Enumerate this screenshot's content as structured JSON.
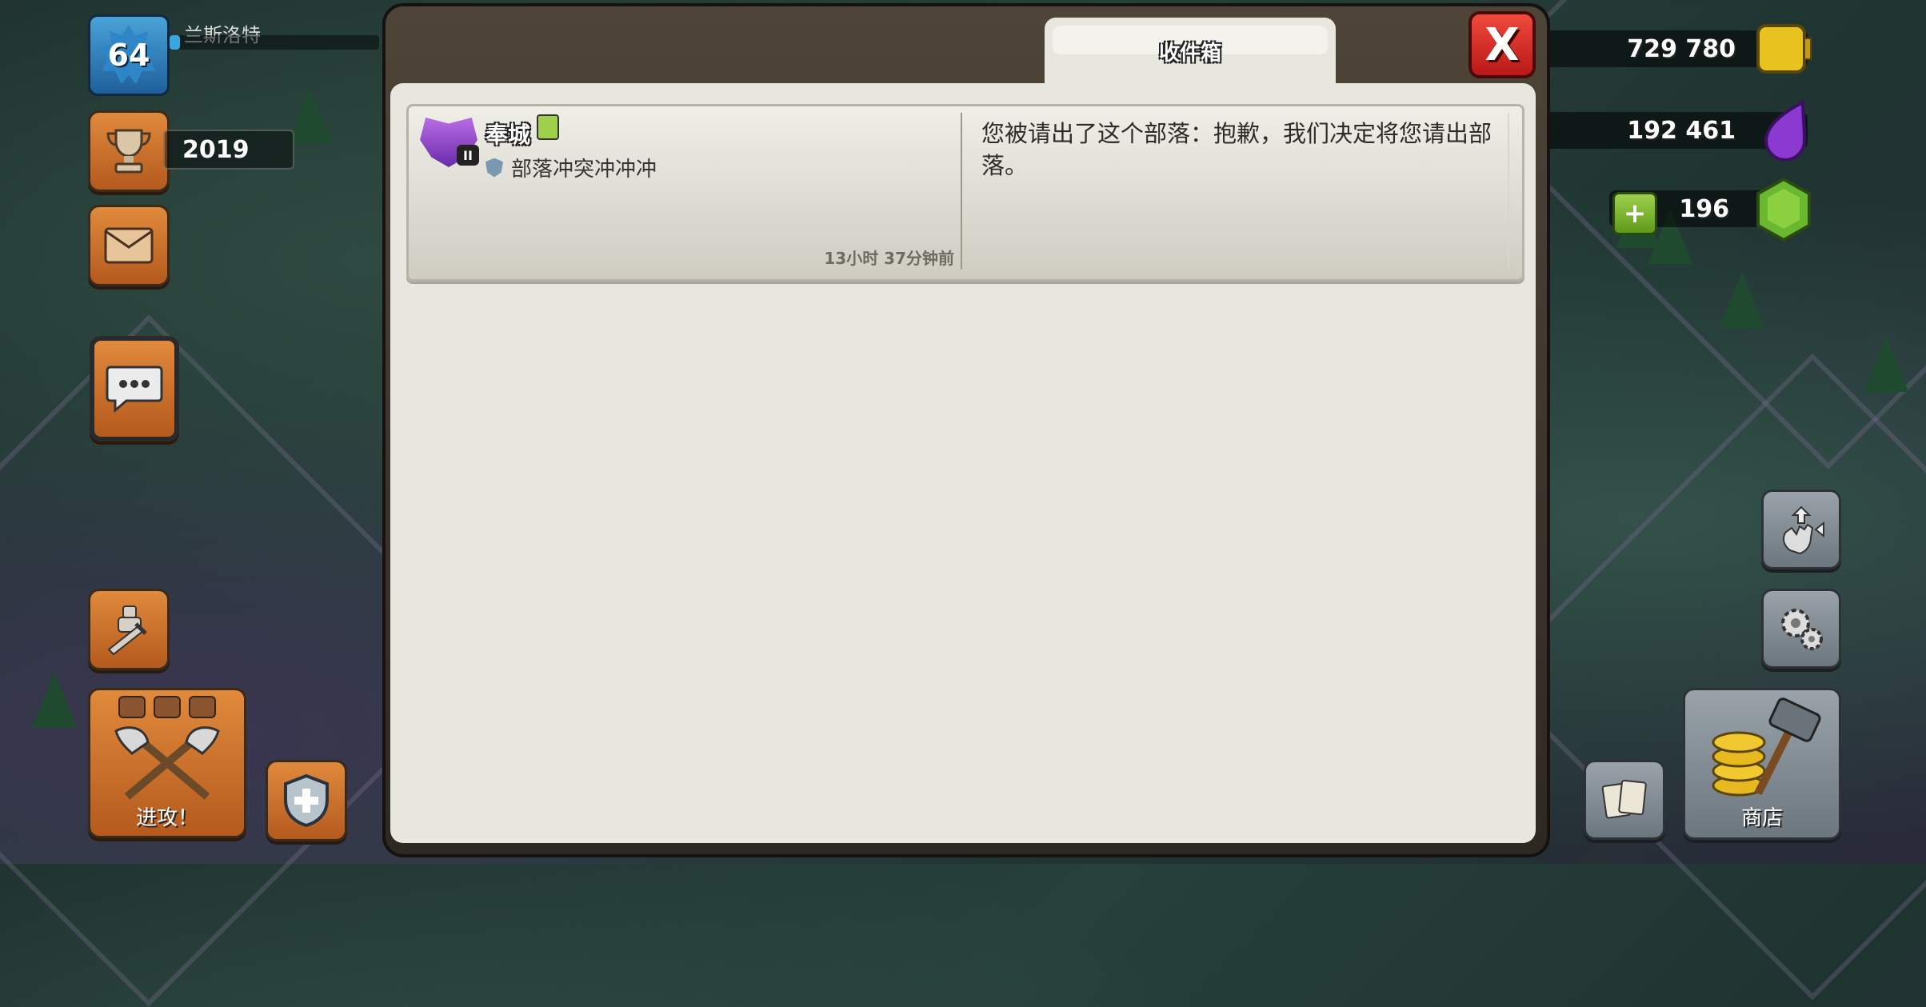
{
  "player": {
    "level": "64",
    "name": "兰斯洛特",
    "trophies": "2019",
    "xp_progress_fraction": 0.05
  },
  "resources": {
    "gold": "729 780",
    "elixir": "192 461",
    "gems": "196"
  },
  "left_buttons": {
    "attack_label": "进攻！"
  },
  "right_buttons": {
    "shop_label": "商店"
  },
  "dialog": {
    "tab_label": "收件箱",
    "close_label": "X"
  },
  "messages": [
    {
      "clan_badge_level": "II",
      "sender": "奉城",
      "clan": "部落冲突冲冲冲",
      "time": "13小时 37分钟前",
      "body": "您被请出了这个部落：抱歉，我们决定将您请出部落。"
    }
  ],
  "colors": {
    "dialog_bg": "#2e2822",
    "panel_bg": "#e8e7df",
    "close_red": "#d02a24",
    "hud_orange": "#c86a28"
  }
}
